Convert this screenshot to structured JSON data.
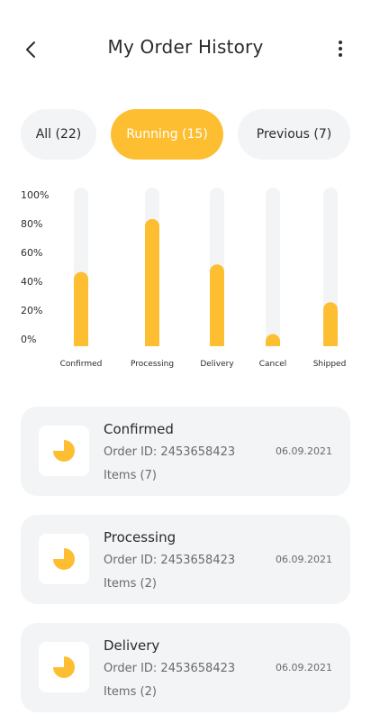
{
  "header": {
    "title": "My Order History",
    "back_icon": "back-arrow-icon",
    "more_icon": "more-vertical-icon"
  },
  "tabs": [
    {
      "label": "All (22)",
      "active": false
    },
    {
      "label": "Running (15)",
      "active": true
    },
    {
      "label": "Previous (7)",
      "active": false
    }
  ],
  "colors": {
    "accent": "#fdbf31",
    "card_bg": "#f3f4f6",
    "track_bg": "#f3f4f6",
    "text": "#2b2b2b"
  },
  "chart_data": {
    "type": "bar",
    "categories": [
      "Confirmed",
      "Processing",
      "Delivery",
      "Cancel",
      "Shipped"
    ],
    "values": [
      49,
      84,
      54,
      8,
      29
    ],
    "y_ticks": [
      "100%",
      "80%",
      "60%",
      "40%",
      "20%",
      "0%"
    ],
    "ylim": [
      0,
      100
    ],
    "grid": false,
    "legend": "none"
  },
  "orders": [
    {
      "status": "Confirmed",
      "order_id": "Order ID: 2453658423",
      "items": "Items (7)",
      "date": "06.09.2021",
      "icon": "pie-chart-icon"
    },
    {
      "status": "Processing",
      "order_id": "Order ID: 2453658423",
      "items": "Items (2)",
      "date": "06.09.2021",
      "icon": "pie-chart-icon"
    },
    {
      "status": "Delivery",
      "order_id": "Order ID: 2453658423",
      "items": "Items (2)",
      "date": "06.09.2021",
      "icon": "pie-chart-icon"
    }
  ]
}
